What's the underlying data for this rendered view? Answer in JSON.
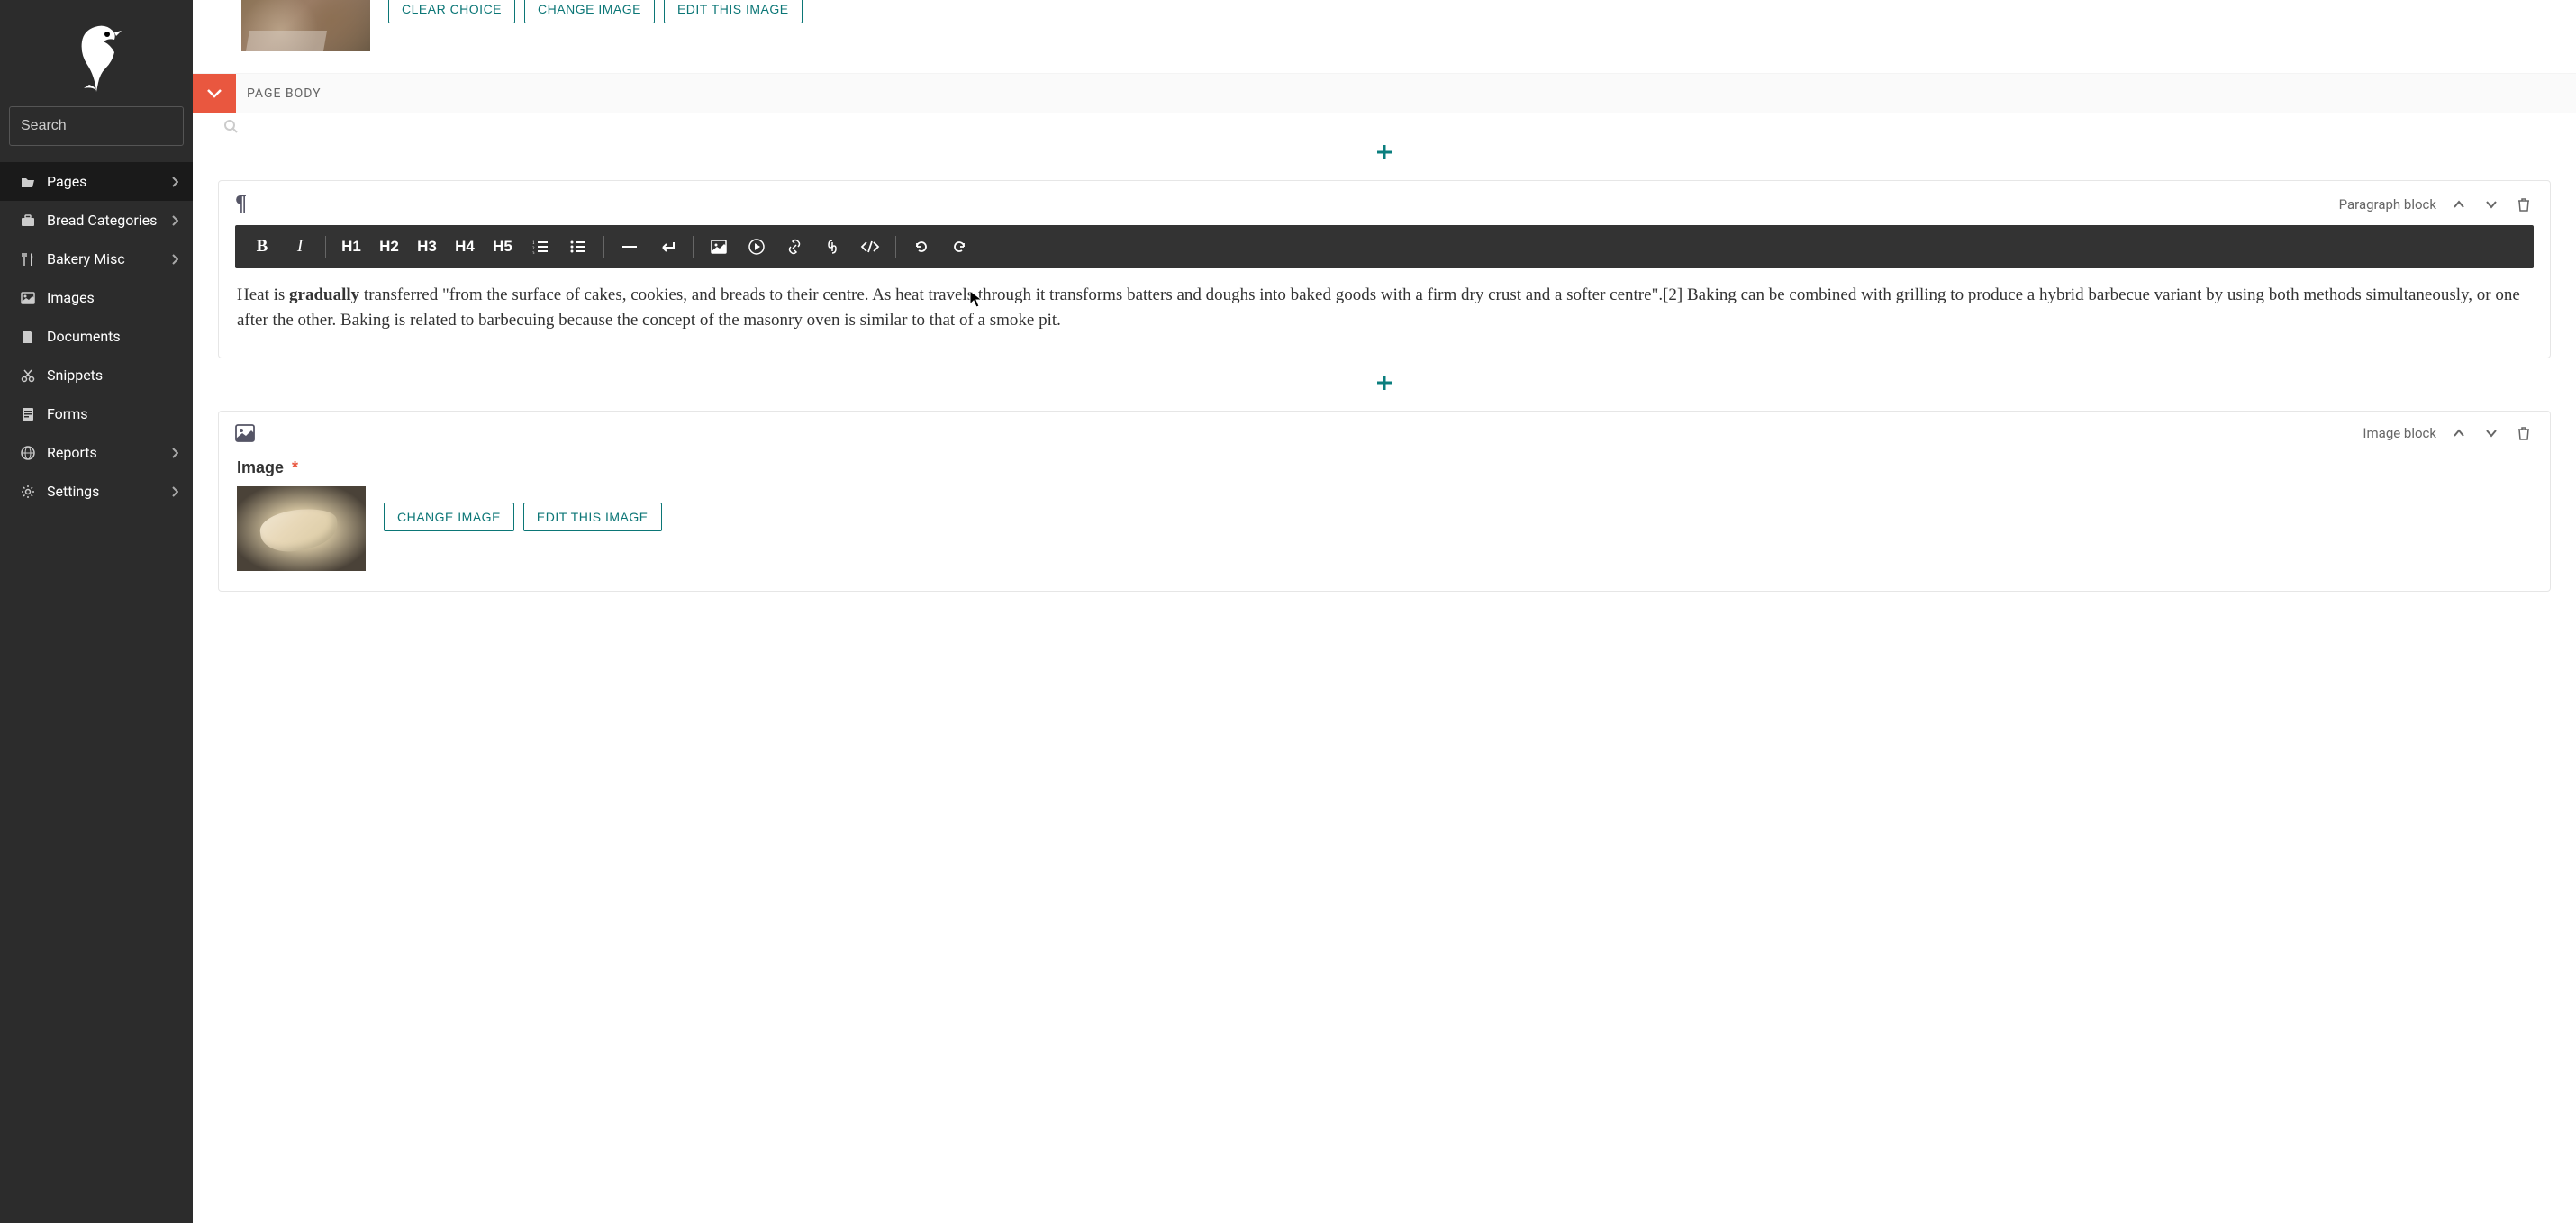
{
  "sidebar": {
    "search_placeholder": "Search",
    "items": [
      {
        "label": "Pages",
        "has_children": true,
        "active": true
      },
      {
        "label": "Bread Categories",
        "has_children": true
      },
      {
        "label": "Bakery Misc",
        "has_children": true
      },
      {
        "label": "Images"
      },
      {
        "label": "Documents"
      },
      {
        "label": "Snippets"
      },
      {
        "label": "Forms"
      },
      {
        "label": "Reports",
        "has_children": true
      },
      {
        "label": "Settings",
        "has_children": true
      }
    ]
  },
  "top_image_actions": {
    "clear": "CLEAR CHOICE",
    "change": "CHANGE IMAGE",
    "edit": "EDIT THIS IMAGE"
  },
  "section": {
    "title": "PAGE BODY"
  },
  "paragraph_block": {
    "type_label": "Paragraph block",
    "toolbar": {
      "h1": "H1",
      "h2": "H2",
      "h3": "H3",
      "h4": "H4",
      "h5": "H5"
    },
    "text_prefix": "Heat is ",
    "text_bold": "gradually",
    "text_rest": " transferred \"from the surface of cakes, cookies, and breads to their centre. As heat travels through it transforms batters and doughs into baked goods with a firm dry crust and a softer centre\".[2] Baking can be combined with grilling to produce a hybrid barbecue variant by using both methods simultaneously, or one after the other. Baking is related to barbecuing because the concept of the masonry oven is similar to that of a smoke pit."
  },
  "image_block": {
    "type_label": "Image block",
    "field_label": "Image",
    "required_mark": "*",
    "change": "CHANGE IMAGE",
    "edit": "EDIT THIS IMAGE"
  }
}
